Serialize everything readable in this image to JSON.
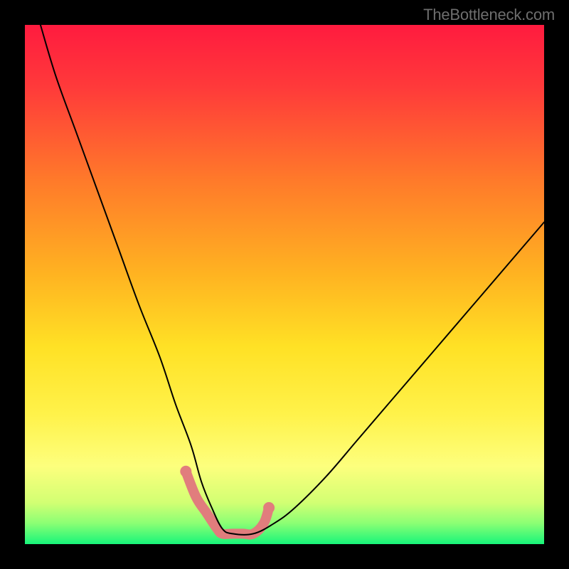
{
  "watermark": "TheBottleneck.com",
  "chart_data": {
    "type": "line",
    "title": "",
    "xlabel": "",
    "ylabel": "",
    "xlim": [
      0,
      100
    ],
    "ylim": [
      0,
      100
    ],
    "grid": false,
    "legend": false,
    "gradient": {
      "type": "vertical",
      "stops": [
        {
          "offset": 0.0,
          "color": "#ff1b3f"
        },
        {
          "offset": 0.12,
          "color": "#ff3a3a"
        },
        {
          "offset": 0.3,
          "color": "#ff7a2a"
        },
        {
          "offset": 0.48,
          "color": "#ffb321"
        },
        {
          "offset": 0.62,
          "color": "#ffe125"
        },
        {
          "offset": 0.75,
          "color": "#fff24a"
        },
        {
          "offset": 0.85,
          "color": "#fdff7d"
        },
        {
          "offset": 0.92,
          "color": "#d2ff73"
        },
        {
          "offset": 0.96,
          "color": "#8bff74"
        },
        {
          "offset": 1.0,
          "color": "#17f57a"
        }
      ]
    },
    "series": [
      {
        "name": "bottleneck-curve",
        "color": "#000000",
        "stroke_width": 2,
        "x": [
          3,
          6,
          10,
          14,
          18,
          22,
          26,
          29,
          32,
          34,
          36,
          38,
          40,
          44,
          48,
          52,
          58,
          64,
          70,
          76,
          82,
          88,
          94,
          100
        ],
        "y": [
          100,
          90,
          79,
          68,
          57,
          46,
          36,
          27,
          19,
          12,
          7,
          3,
          2,
          2,
          4,
          7,
          13,
          20,
          27,
          34,
          41,
          48,
          55,
          62
        ]
      }
    ],
    "highlight": {
      "name": "highlight-band",
      "color": "#e17d7d",
      "stroke_width": 14,
      "x": [
        31,
        33,
        35,
        37,
        38,
        40,
        42,
        44,
        46,
        47
      ],
      "y": [
        14,
        9,
        6,
        3,
        2,
        2,
        2,
        2,
        4,
        7
      ],
      "endpoints": [
        {
          "x": 31,
          "y": 14
        },
        {
          "x": 47,
          "y": 7
        }
      ]
    }
  }
}
